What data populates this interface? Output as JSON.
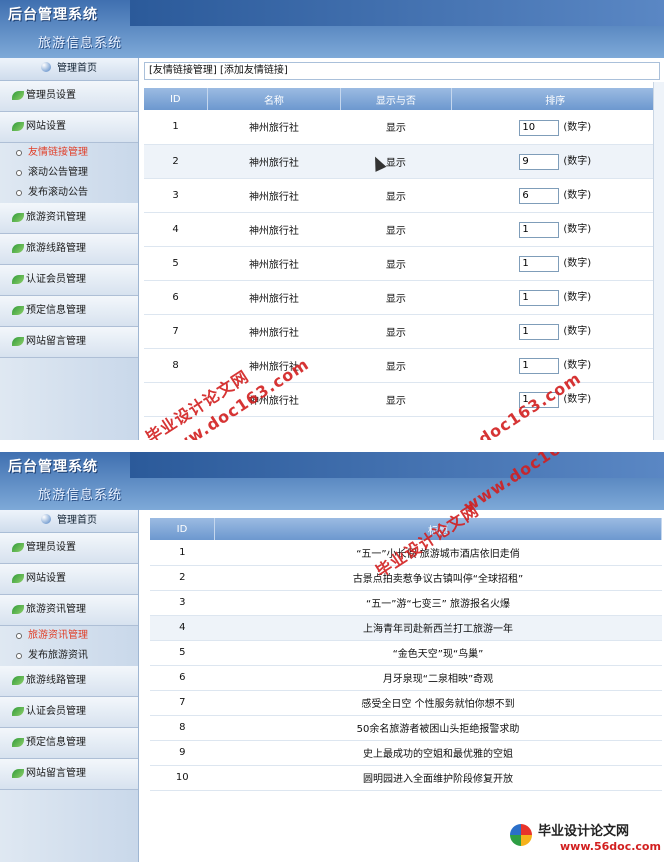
{
  "panel1": {
    "logo": "后台管理系统",
    "subtitle": "旅游信息系统",
    "home_label": "管理首页",
    "menu": [
      {
        "label": "管理员设置",
        "type": "cat"
      },
      {
        "label": "网站设置",
        "type": "cat"
      },
      {
        "label": "友情链接管理",
        "type": "sub",
        "active": true
      },
      {
        "label": "滚动公告管理",
        "type": "sub"
      },
      {
        "label": "发布滚动公告",
        "type": "sub"
      },
      {
        "label": "旅游资讯管理",
        "type": "cat"
      },
      {
        "label": "旅游线路管理",
        "type": "cat"
      },
      {
        "label": "认证会员管理",
        "type": "cat"
      },
      {
        "label": "预定信息管理",
        "type": "cat"
      },
      {
        "label": "网站留言管理",
        "type": "cat"
      }
    ],
    "breadcrumb": "[友情链接管理] [添加友情链接]",
    "columns": [
      "ID",
      "名称",
      "显示与否",
      "排序"
    ],
    "rows": [
      {
        "id": "1",
        "name": "神州旅行社",
        "show": "显示",
        "sort": "10",
        "note": "(数字)"
      },
      {
        "id": "2",
        "name": "神州旅行社",
        "show": "显示",
        "sort": "9",
        "note": "(数字)"
      },
      {
        "id": "3",
        "name": "神州旅行社",
        "show": "显示",
        "sort": "6",
        "note": "(数字)"
      },
      {
        "id": "4",
        "name": "神州旅行社",
        "show": "显示",
        "sort": "1",
        "note": "(数字)"
      },
      {
        "id": "5",
        "name": "神州旅行社",
        "show": "显示",
        "sort": "1",
        "note": "(数字)"
      },
      {
        "id": "6",
        "name": "神州旅行社",
        "show": "显示",
        "sort": "1",
        "note": "(数字)"
      },
      {
        "id": "7",
        "name": "神州旅行社",
        "show": "显示",
        "sort": "1",
        "note": "(数字)"
      },
      {
        "id": "8",
        "name": "神州旅行社",
        "show": "显示",
        "sort": "1",
        "note": "(数字)"
      },
      {
        "id": "",
        "name": "神州旅行社",
        "show": "显示",
        "sort": "1",
        "note": "(数字)"
      }
    ]
  },
  "panel2": {
    "logo": "后台管理系统",
    "subtitle": "旅游信息系统",
    "home_label": "管理首页",
    "menu": [
      {
        "label": "管理员设置",
        "type": "cat"
      },
      {
        "label": "网站设置",
        "type": "cat"
      },
      {
        "label": "旅游资讯管理",
        "type": "cat"
      },
      {
        "label": "旅游资讯管理",
        "type": "sub",
        "active": true
      },
      {
        "label": "发布旅游资讯",
        "type": "sub"
      },
      {
        "label": "旅游线路管理",
        "type": "cat"
      },
      {
        "label": "认证会员管理",
        "type": "cat"
      },
      {
        "label": "预定信息管理",
        "type": "cat"
      },
      {
        "label": "网站留言管理",
        "type": "cat"
      }
    ],
    "columns": [
      "ID",
      "标题"
    ],
    "rows": [
      {
        "id": "1",
        "title": "“五一”小长假 旅游城市酒店依旧走俏"
      },
      {
        "id": "2",
        "title": "古景点拍卖惹争议古镇叫停“全球招租”"
      },
      {
        "id": "3",
        "title": "“五一”游“七变三” 旅游报名火爆"
      },
      {
        "id": "4",
        "title": "上海青年司赴新西兰打工旅游一年"
      },
      {
        "id": "5",
        "title": "“金色天空”现“鸟巢”"
      },
      {
        "id": "6",
        "title": "月牙泉现“二泉相映”奇观"
      },
      {
        "id": "7",
        "title": "感受全日空 个性服务就怕你想不到"
      },
      {
        "id": "8",
        "title": "50余名旅游者被困山头拒绝报警求助"
      },
      {
        "id": "9",
        "title": "史上最成功的空姐和最优雅的空姐"
      },
      {
        "id": "10",
        "title": "圆明园进入全面维护阶段修复开放"
      }
    ]
  },
  "watermarks": {
    "w1": "毕业设计论文网",
    "w2": "www.doc163.com",
    "w3": "毕业设计论文网",
    "w4": "www.doc163.com",
    "w5": "毕业设计论文网",
    "w6": "www.doc163.com"
  },
  "footer": {
    "title": "毕业设计论文网",
    "url": "www.56doc.com"
  }
}
